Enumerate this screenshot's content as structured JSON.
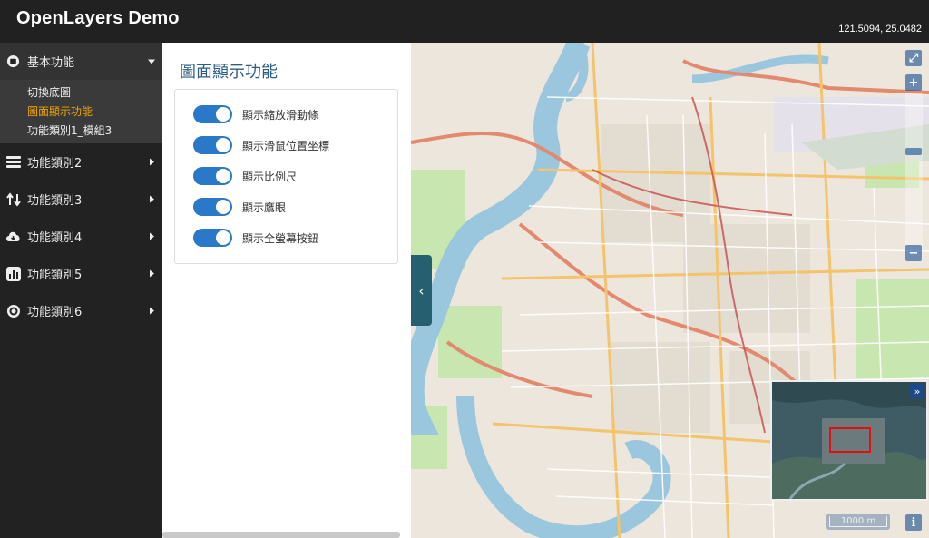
{
  "header": {
    "title": "OpenLayers Demo",
    "coordinates": "121.5094, 25.0482"
  },
  "sidebar": {
    "items": [
      {
        "label": "基本功能",
        "icon": "globe-icon",
        "open": true,
        "children": [
          "切換底圖",
          "圖面顯示功能",
          "功能類別1_模組3"
        ],
        "active_child": 1
      },
      {
        "label": "功能類別2",
        "icon": "layers-icon"
      },
      {
        "label": "功能類別3",
        "icon": "route-icon"
      },
      {
        "label": "功能類別4",
        "icon": "cloud-icon"
      },
      {
        "label": "功能類別5",
        "icon": "chart-icon"
      },
      {
        "label": "功能類別6",
        "icon": "settings-icon"
      }
    ]
  },
  "panel": {
    "title": "圖面顯示功能",
    "toggles": [
      {
        "label": "顯示縮放滑動條",
        "checked": true
      },
      {
        "label": "顯示滑鼠位置坐標",
        "checked": true
      },
      {
        "label": "顯示比例尺",
        "checked": true
      },
      {
        "label": "顯示鷹眼",
        "checked": true
      },
      {
        "label": "顯示全螢幕按鈕",
        "checked": true
      }
    ]
  },
  "map": {
    "collapse_symbol": "‹",
    "fullscreen_symbol": "⤢",
    "zoom_in": "+",
    "zoom_out": "−",
    "overview_toggle": "»",
    "info": "i",
    "scale_label": "1000 m"
  },
  "colors": {
    "accent": "#2a79c8",
    "active": "#f0a500",
    "title": "#2c5e85",
    "header": "#212121"
  }
}
